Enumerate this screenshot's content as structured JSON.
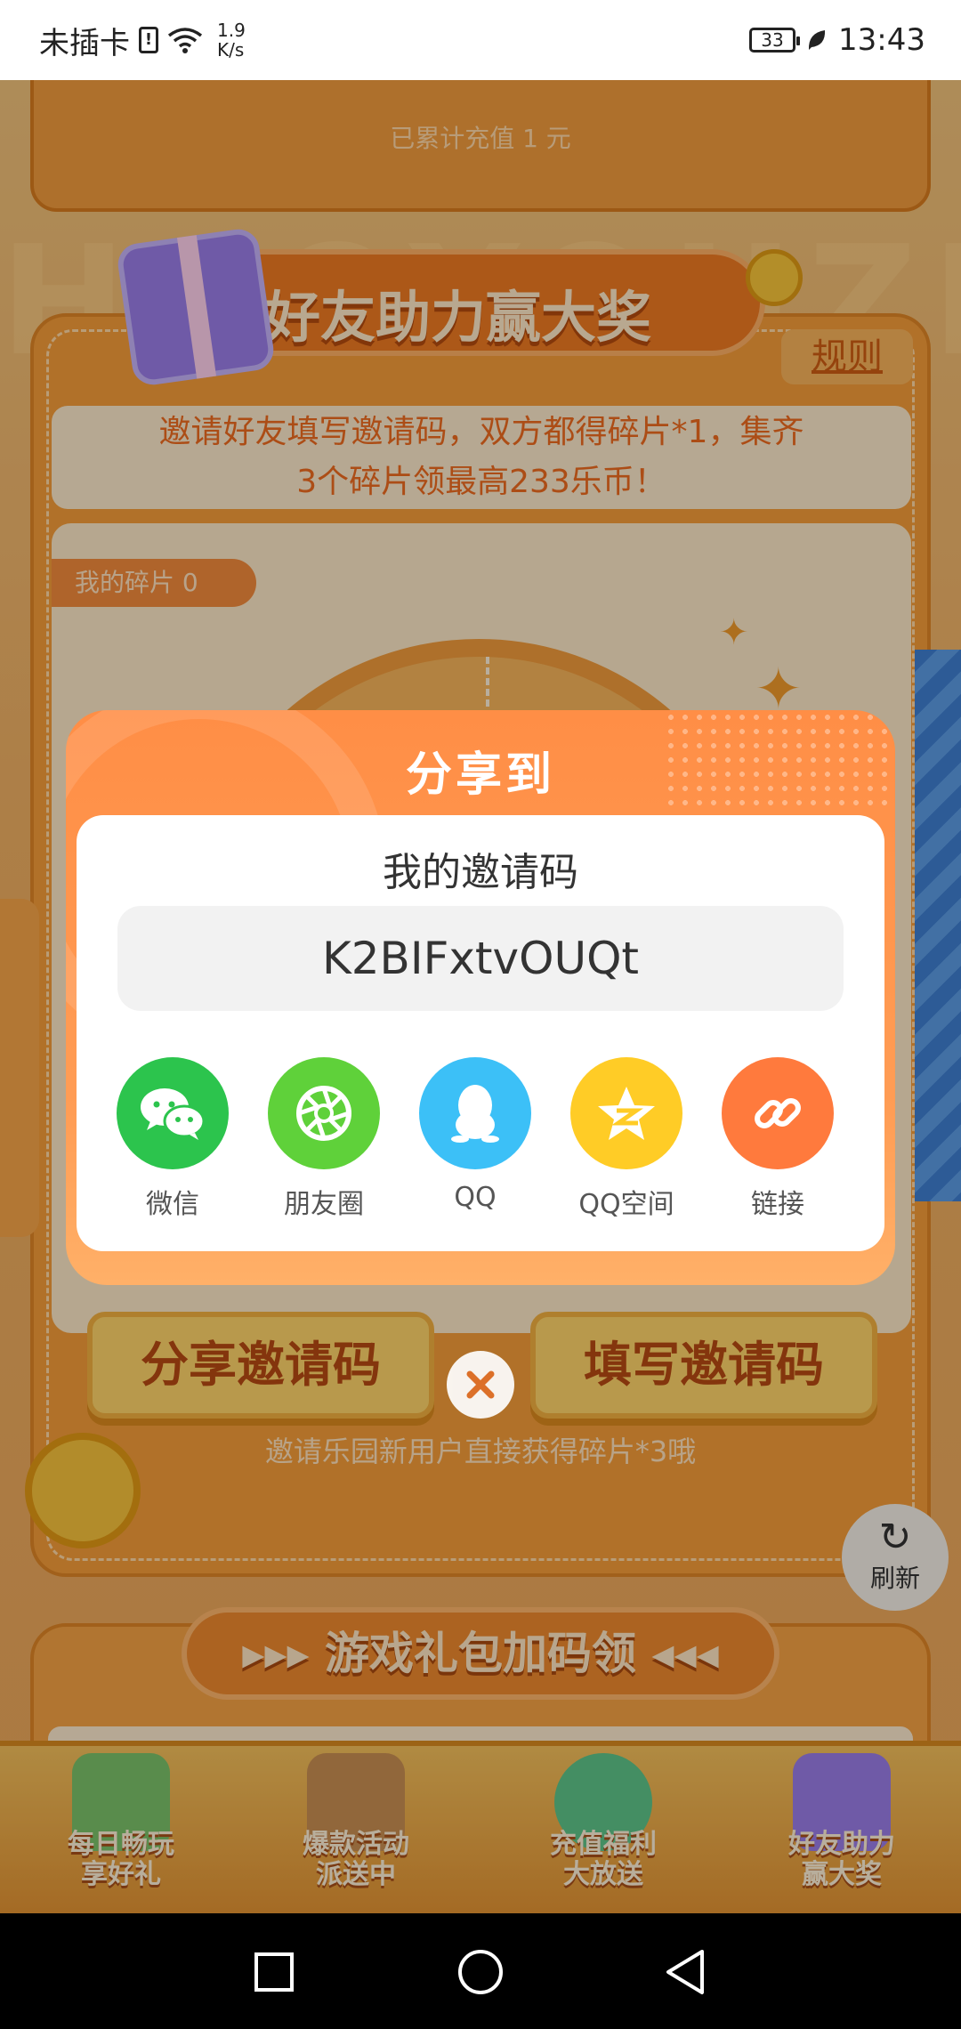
{
  "status_bar": {
    "carrier": "未插卡",
    "speed_value": "1.9",
    "speed_unit": "K/s",
    "battery": "33",
    "time": "13:43"
  },
  "background": {
    "top_card_text": "已累计充值 1 元",
    "watermark": "HAOYOUZHULI",
    "section_title": "好友助力赢大奖",
    "rules": "规则",
    "description_line1": "邀请好友填写邀请码，双方都得碎片*1，集齐",
    "description_line2": "3个碎片领最高233乐币！",
    "pieces_tag": "我的碎片 0",
    "share_code_button": "分享邀请码",
    "fill_code_button": "填写邀请码",
    "hint": "邀请乐园新用户直接获得碎片*3哦",
    "refresh": "刷新",
    "second_section_title": "▸▸▸ 游戏礼包加码领 ◂◂◂"
  },
  "bottom_nav": [
    {
      "label": "每日畅玩\n享好礼",
      "icon": "island-icon",
      "color": "#7cc26a"
    },
    {
      "label": "爆款活动\n派送中",
      "icon": "summer-sign-icon",
      "color": "#c98f52"
    },
    {
      "label": "充值福利\n大放送",
      "icon": "coconut-icon",
      "color": "#5fc58a"
    },
    {
      "label": "好友助力\n赢大奖",
      "icon": "gift-box-icon",
      "color": "#9a7de8"
    }
  ],
  "modal": {
    "title": "分享到",
    "invite_label": "我的邀请码",
    "invite_code": "K2BIFxtvOUQt",
    "share_targets": [
      {
        "label": "微信",
        "icon": "wechat-icon",
        "color": "#2cc44d"
      },
      {
        "label": "朋友圈",
        "icon": "moments-icon",
        "color": "#5fd13a"
      },
      {
        "label": "QQ",
        "icon": "qq-icon",
        "color": "#3cc0f7"
      },
      {
        "label": "QQ空间",
        "icon": "qzone-icon",
        "color": "#ffcc26"
      },
      {
        "label": "链接",
        "icon": "link-icon",
        "color": "#ff7a3d"
      }
    ]
  },
  "colors": {
    "accent": "#ff8e46",
    "overlay": "rgba(0,0,0,0.28)"
  }
}
